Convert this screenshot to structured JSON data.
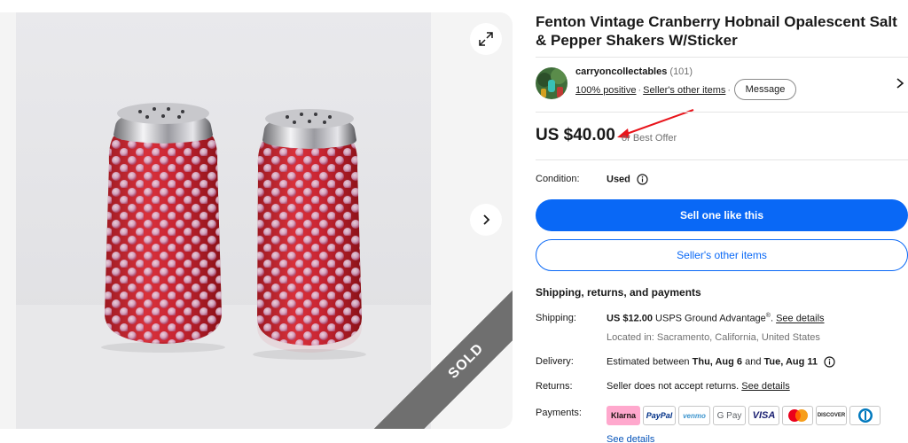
{
  "listing": {
    "title": "Fenton Vintage Cranberry Hobnail Opalescent Salt & Pepper Shakers W/Sticker",
    "sold_label": "SOLD"
  },
  "seller": {
    "name": "carryoncollectables",
    "feedback_count": "(101)",
    "positive": "100% positive",
    "other_items_link": "Seller's other items",
    "message_label": "Message"
  },
  "price": {
    "amount": "US $40.00",
    "best_offer": "or Best Offer"
  },
  "condition": {
    "label": "Condition:",
    "value": "Used"
  },
  "actions": {
    "sell_one": "Sell one like this",
    "other_items": "Seller's other items"
  },
  "shipping_section": {
    "title": "Shipping, returns, and payments",
    "shipping_label": "Shipping:",
    "shipping_cost": "US $12.00",
    "shipping_service": "USPS Ground Advantage",
    "shipping_reg": "®",
    "see_details": "See details",
    "location": "Located in: Sacramento, California, United States",
    "delivery_label": "Delivery:",
    "delivery_prefix": "Estimated between",
    "delivery_start": "Thu, Aug 6",
    "delivery_and": "and",
    "delivery_end": "Tue, Aug 11",
    "returns_label": "Returns:",
    "returns_value": "Seller does not accept returns.",
    "payments_label": "Payments:",
    "payments": {
      "klarna": "Klarna",
      "paypal": "PayPal",
      "venmo": "venmo",
      "gpay": "G Pay",
      "visa": "VISA",
      "discover": "DISCOVER"
    },
    "payments_see_details": "See details"
  },
  "colors": {
    "primary_blue": "#0968f6",
    "annotation_red": "#e8141b",
    "sold_band": "#6f6f6f"
  }
}
